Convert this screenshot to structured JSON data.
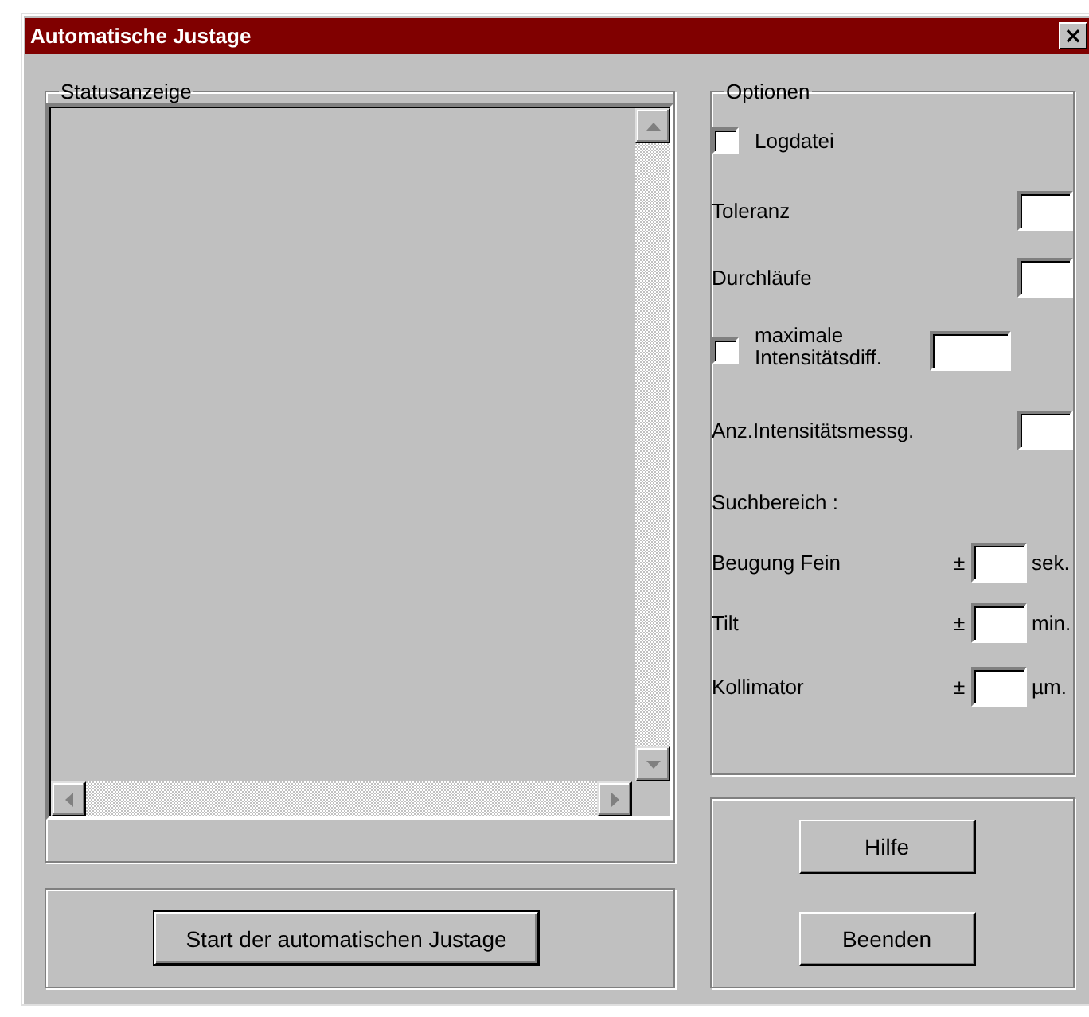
{
  "window": {
    "title": "Automatische Justage",
    "close": "×"
  },
  "status_group": {
    "label": "Statusanzeige"
  },
  "start_button": "Start der automatischen Justage",
  "options": {
    "label": "Optionen",
    "items": [
      {
        "kind": "checkbox",
        "label": "Logdatei",
        "checked": false
      },
      {
        "kind": "field",
        "label": "Toleranz"
      },
      {
        "kind": "field",
        "label": "Durchläufe"
      },
      {
        "kind": "checkfield",
        "label": "maximale Intensitätsdiff.",
        "checked": false
      },
      {
        "kind": "field",
        "label": "Anz.Intensitätsmessg."
      },
      {
        "kind": "heading",
        "label": "Suchbereich :"
      },
      {
        "kind": "range",
        "label": "Beugung Fein",
        "prefix": "±",
        "unit": "sek."
      },
      {
        "kind": "range",
        "label": "Tilt",
        "prefix": "±",
        "unit": "min."
      },
      {
        "kind": "range",
        "label": "Kollimator",
        "prefix": "±",
        "unit": "µm."
      }
    ]
  },
  "buttons": [
    "Hilfe",
    "Beenden"
  ]
}
